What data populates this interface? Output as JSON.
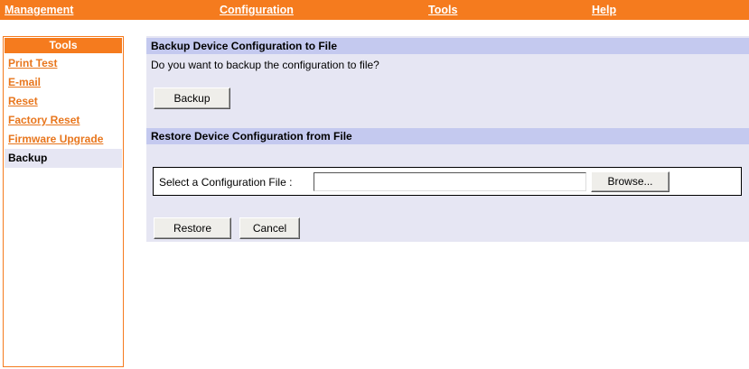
{
  "topnav": {
    "items": [
      "Management",
      "Configuration",
      "Tools",
      "Help"
    ]
  },
  "sidebar": {
    "title": "Tools",
    "items": [
      {
        "label": "Print Test"
      },
      {
        "label": "E-mail"
      },
      {
        "label": "Reset"
      },
      {
        "label": "Factory Reset"
      },
      {
        "label": "Firmware Upgrade"
      },
      {
        "label": "Backup",
        "active": true
      }
    ]
  },
  "backup_section": {
    "title": "Backup Device Configuration to File",
    "question": "Do you want to backup the configuration to file?",
    "backup_button": "Backup"
  },
  "restore_section": {
    "title": "Restore Device Configuration from File",
    "file_label": "Select a Configuration File :",
    "file_value": "",
    "browse_button": "Browse...",
    "restore_button": "Restore",
    "cancel_button": "Cancel"
  },
  "colors": {
    "accent": "#f57b1e",
    "panel_bg": "#e6e6f3",
    "section_header_bg": "#c4c9ef"
  }
}
